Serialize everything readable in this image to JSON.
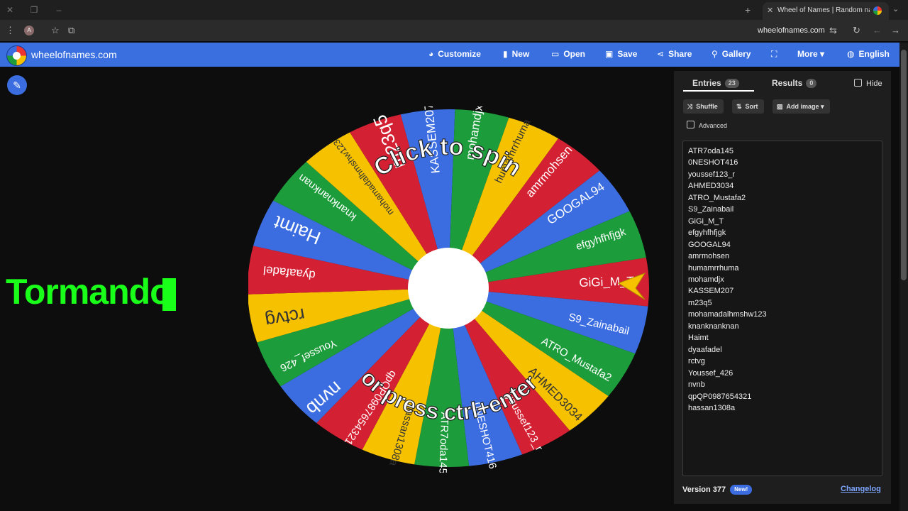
{
  "browser": {
    "tab_title": "Wheel of Names | Random nam",
    "url": "wheelofnames.com",
    "avatar_letter": "A"
  },
  "app": {
    "brand": "wheelofnames.com",
    "menu": {
      "customize": "Customize",
      "new": "New",
      "open": "Open",
      "save": "Save",
      "share": "Share",
      "gallery": "Gallery",
      "more": "More",
      "language": "English"
    }
  },
  "overlay_text": "Tormando",
  "wheel": {
    "top_text": "Click to spin",
    "bottom_text": "or press ctrl+enter",
    "segment_colors": [
      "#d42033",
      "#3b6de0",
      "#1c9c3a",
      "#f6c200"
    ],
    "segments": [
      "GiGi_M_T",
      "S9_Zainabail",
      "ATRO_Mustafa2",
      "AHMED3034",
      "youssef123_r",
      "0NESHOT416",
      "ATR7oda145",
      "hassan1308a",
      "qpQP0987654321",
      "nvnb",
      "Youssef_426",
      "rctvg",
      "dyaafadel",
      "Haimt",
      "knanknanknan",
      "mohamadalhmshw123",
      "m23q5",
      "KASSEM207",
      "mohamdjx",
      "humamrrhuma",
      "amrmohsen",
      "GOOGAL94",
      "efgyhfhfjgk"
    ]
  },
  "panel": {
    "entries_tab": "Entries",
    "entries_count": "23",
    "results_tab": "Results",
    "results_count": "0",
    "hide_label": "Hide",
    "shuffle": "Shuffle",
    "sort": "Sort",
    "add_image": "Add image",
    "advanced": "Advanced",
    "entries": [
      "ATR7oda145",
      "0NESHOT416",
      "youssef123_r",
      "AHMED3034",
      "ATRO_Mustafa2",
      "S9_Zainabail",
      "GiGi_M_T",
      "efgyhfhfjgk",
      "GOOGAL94",
      "amrmohsen",
      "humamrrhuma",
      "mohamdjx",
      "KASSEM207",
      "m23q5",
      "mohamadalhmshw123",
      "knanknanknan",
      "Haimt",
      "dyaafadel",
      "rctvg",
      "Youssef_426",
      "nvnb",
      "qpQP0987654321",
      "hassan1308a"
    ],
    "version_label": "Version 377",
    "new_badge": "New!",
    "changelog": "Changelog"
  }
}
